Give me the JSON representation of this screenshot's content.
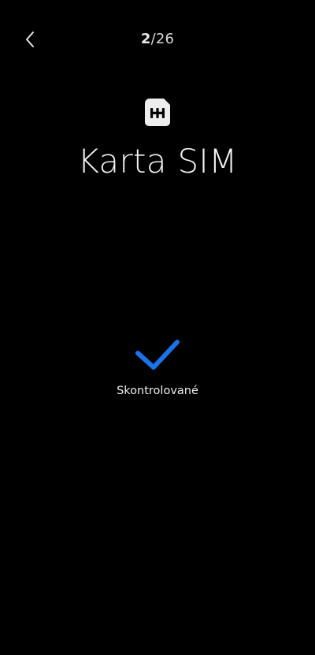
{
  "header": {
    "back_icon": "chevron-left-icon",
    "page_current": "2",
    "page_separator_total": "/26"
  },
  "main": {
    "icon": "sim-card-icon",
    "title": "Karta SIM",
    "status_icon": "checkmark-icon",
    "status_label": "Skontrolované"
  },
  "colors": {
    "background": "#000000",
    "accent": "#1a73e8",
    "text": "#ffffff"
  }
}
